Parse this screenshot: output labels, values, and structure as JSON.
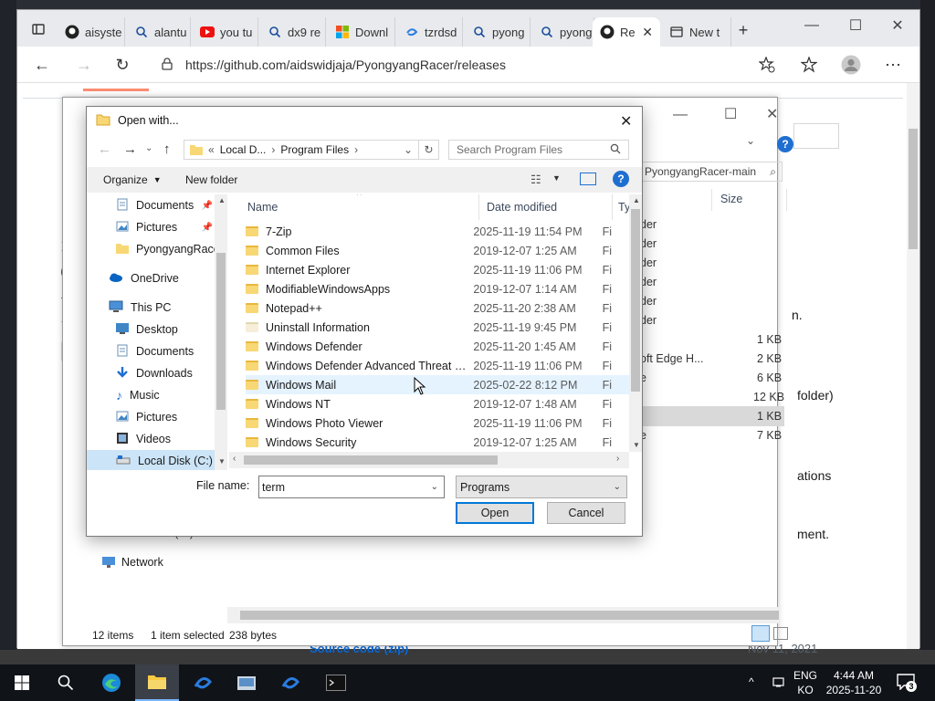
{
  "browser": {
    "tabs": [
      {
        "label": "aisyste",
        "icon": "github-icon"
      },
      {
        "label": "alantu",
        "icon": "search-icon"
      },
      {
        "label": "you tu",
        "icon": "youtube-icon"
      },
      {
        "label": "dx9 re",
        "icon": "search-icon"
      },
      {
        "label": "Downl",
        "icon": "windows-logo-icon"
      },
      {
        "label": "tzrdsd",
        "icon": "swirl-icon"
      },
      {
        "label": "pyong",
        "icon": "search-icon"
      },
      {
        "label": "pyong",
        "icon": "search-icon"
      },
      {
        "label": "Re",
        "icon": "github-icon",
        "active": true
      },
      {
        "label": "New t",
        "icon": "newtab-icon"
      }
    ],
    "url": "https://github.com/aidswidjaja/PyongyangRacer/releases",
    "page_fragments": {
      "ma": "Ma",
      "c": "C",
      "source_code": "Source code (zip)",
      "date": "Nov 11, 2021",
      "n": "n.",
      "folder": "folder)",
      "ations": "ations",
      "ment": "ment."
    }
  },
  "explorer_bg": {
    "search": "PyongyangRacer-main",
    "col_size": "Size",
    "rows": [
      {
        "type": "der",
        "size": ""
      },
      {
        "type": "der",
        "size": ""
      },
      {
        "type": "der",
        "size": ""
      },
      {
        "type": "der",
        "size": ""
      },
      {
        "type": "der",
        "size": ""
      },
      {
        "type": "der",
        "size": ""
      },
      {
        "type": "",
        "size": "1 KB"
      },
      {
        "type": "oft Edge H...",
        "size": "2 KB"
      },
      {
        "type": "e",
        "size": "6 KB"
      },
      {
        "type": "",
        "size": "12 KB"
      },
      {
        "type": "",
        "size": "1 KB"
      },
      {
        "type": "e",
        "size": "7 KB"
      }
    ],
    "nav_extra": "CD Drive (D:) VirtIO-",
    "network": "Network",
    "status_items": "12 items",
    "status_selected": "1 item selected",
    "status_bytes": "238 bytes"
  },
  "dialog": {
    "title": "Open with...",
    "breadcrumb": [
      "Local D...",
      "Program Files"
    ],
    "search_placeholder": "Search Program Files",
    "organize": "Organize",
    "new_folder": "New folder",
    "nav": [
      {
        "label": "Documents",
        "icon": "documents-icon",
        "pinned": true
      },
      {
        "label": "Pictures",
        "icon": "pictures-icon",
        "pinned": true
      },
      {
        "label": "PyongyangRace",
        "icon": "folder-icon"
      },
      {
        "label": "OneDrive",
        "icon": "onedrive-icon"
      },
      {
        "label": "This PC",
        "icon": "pc-icon"
      },
      {
        "label": "Desktop",
        "icon": "desktop-icon"
      },
      {
        "label": "Documents",
        "icon": "documents-icon"
      },
      {
        "label": "Downloads",
        "icon": "downloads-icon"
      },
      {
        "label": "Music",
        "icon": "music-icon"
      },
      {
        "label": "Pictures",
        "icon": "pictures-icon"
      },
      {
        "label": "Videos",
        "icon": "videos-icon"
      },
      {
        "label": "Local Disk (C:)",
        "icon": "disk-icon",
        "selected": true
      }
    ],
    "columns": {
      "name": "Name",
      "date": "Date modified",
      "type": "Ty"
    },
    "files": [
      {
        "name": "7-Zip",
        "date": "2025-11-19 11:54 PM",
        "type": "Fi"
      },
      {
        "name": "Common Files",
        "date": "2019-12-07 1:25 AM",
        "type": "Fi"
      },
      {
        "name": "Internet Explorer",
        "date": "2025-11-19 11:06 PM",
        "type": "Fi"
      },
      {
        "name": "ModifiableWindowsApps",
        "date": "2019-12-07 1:14 AM",
        "type": "Fi"
      },
      {
        "name": "Notepad++",
        "date": "2025-11-20 2:38 AM",
        "type": "Fi"
      },
      {
        "name": "Uninstall Information",
        "date": "2025-11-19 9:45 PM",
        "type": "Fi",
        "hidden": true
      },
      {
        "name": "Windows Defender",
        "date": "2025-11-20 1:45 AM",
        "type": "Fi"
      },
      {
        "name": "Windows Defender Advanced Threat Prot...",
        "date": "2025-11-19 11:06 PM",
        "type": "Fi"
      },
      {
        "name": "Windows Mail",
        "date": "2025-02-22 8:12 PM",
        "type": "Fi",
        "hover": true
      },
      {
        "name": "Windows NT",
        "date": "2019-12-07 1:48 AM",
        "type": "Fi"
      },
      {
        "name": "Windows Photo Viewer",
        "date": "2025-11-19 11:06 PM",
        "type": "Fi"
      },
      {
        "name": "Windows Security",
        "date": "2019-12-07 1:25 AM",
        "type": "Fi"
      }
    ],
    "file_name_label": "File name:",
    "file_name_value": "term",
    "file_type": "Programs",
    "open": "Open",
    "cancel": "Cancel"
  },
  "taskbar": {
    "lang_top": "ENG",
    "lang_bottom": "KO",
    "time": "4:44 AM",
    "date": "2025-11-20",
    "notifications": "3"
  },
  "colors": {
    "accent": "#0078d7",
    "selection": "#cce4f7",
    "folder": "#f8d775",
    "taskbar": "#101318"
  }
}
